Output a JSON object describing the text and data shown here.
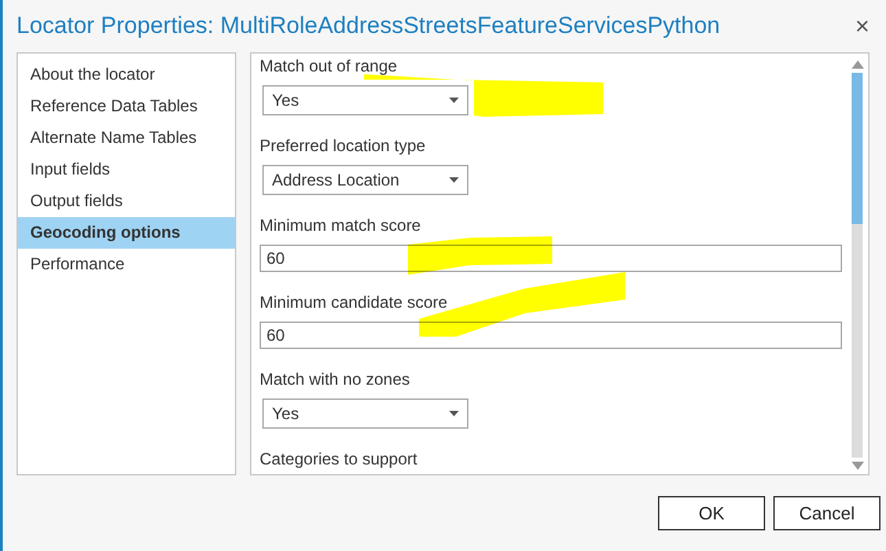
{
  "window": {
    "title": "Locator Properties: MultiRoleAddressStreetsFeatureServicesPython",
    "close": "×"
  },
  "sidebar": {
    "items": [
      {
        "label": "About the locator",
        "selected": false
      },
      {
        "label": "Reference Data Tables",
        "selected": false
      },
      {
        "label": "Alternate Name Tables",
        "selected": false
      },
      {
        "label": "Input fields",
        "selected": false
      },
      {
        "label": "Output fields",
        "selected": false
      },
      {
        "label": "Geocoding options",
        "selected": true
      },
      {
        "label": "Performance",
        "selected": false
      }
    ]
  },
  "options": [
    {
      "label": "Match out of range",
      "kind": "dropdown",
      "value": "Yes"
    },
    {
      "label": "Preferred location type",
      "kind": "dropdown",
      "value": "Address Location"
    },
    {
      "label": "Minimum match score",
      "kind": "text",
      "value": "60"
    },
    {
      "label": "Minimum candidate score",
      "kind": "text",
      "value": "60"
    },
    {
      "label": "Match with no zones",
      "kind": "dropdown",
      "value": "Yes"
    },
    {
      "label": "Categories to support",
      "kind": "label"
    }
  ],
  "buttons": [
    "OK",
    "Cancel"
  ]
}
